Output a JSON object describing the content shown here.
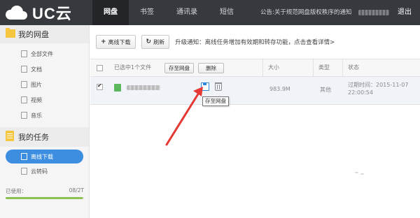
{
  "app": {
    "logo_text": "UC云"
  },
  "topnav": {
    "items": [
      {
        "label": "网盘",
        "active": true
      },
      {
        "label": "书签",
        "active": false
      },
      {
        "label": "通讯录",
        "active": false
      },
      {
        "label": "短信",
        "active": false
      }
    ],
    "notice": "公告:关于规范网盘版权秩序的通知",
    "logout": "退出"
  },
  "sidebar": {
    "disk_title": "我的网盘",
    "disk_items": [
      {
        "label": "全部文件",
        "icon": "files-icon"
      },
      {
        "label": "文档",
        "icon": "document-icon"
      },
      {
        "label": "图片",
        "icon": "image-icon"
      },
      {
        "label": "视频",
        "icon": "video-icon"
      },
      {
        "label": "音乐",
        "icon": "music-icon"
      }
    ],
    "task_title": "我的任务",
    "task_items": [
      {
        "label": "离线下载",
        "active": true
      },
      {
        "label": "云转码",
        "active": false
      }
    ],
    "usage_label": "已使用：",
    "usage_value": "08/2T",
    "usage_fraction": 0.98
  },
  "toolbar": {
    "offline_button": "离线下载",
    "refresh_button": "刷新",
    "promo": "升级通知：离线任务增加有效期和转存功能，点击查看详情>"
  },
  "table": {
    "selected_text": "已选中1个文件",
    "save_button": "存至网盘",
    "delete_button": "删除",
    "col_size": "大小",
    "col_type": "类型",
    "col_status": "状态",
    "row": {
      "size": "983.9M",
      "type": "其他",
      "status_line1": "过期时间：2015-11-07",
      "status_line2": "22:00:54"
    },
    "tooltip": "存至网盘"
  },
  "colors": {
    "topbar": "#36393e",
    "accent": "#3d8ee0",
    "arrow": "#e53935"
  }
}
